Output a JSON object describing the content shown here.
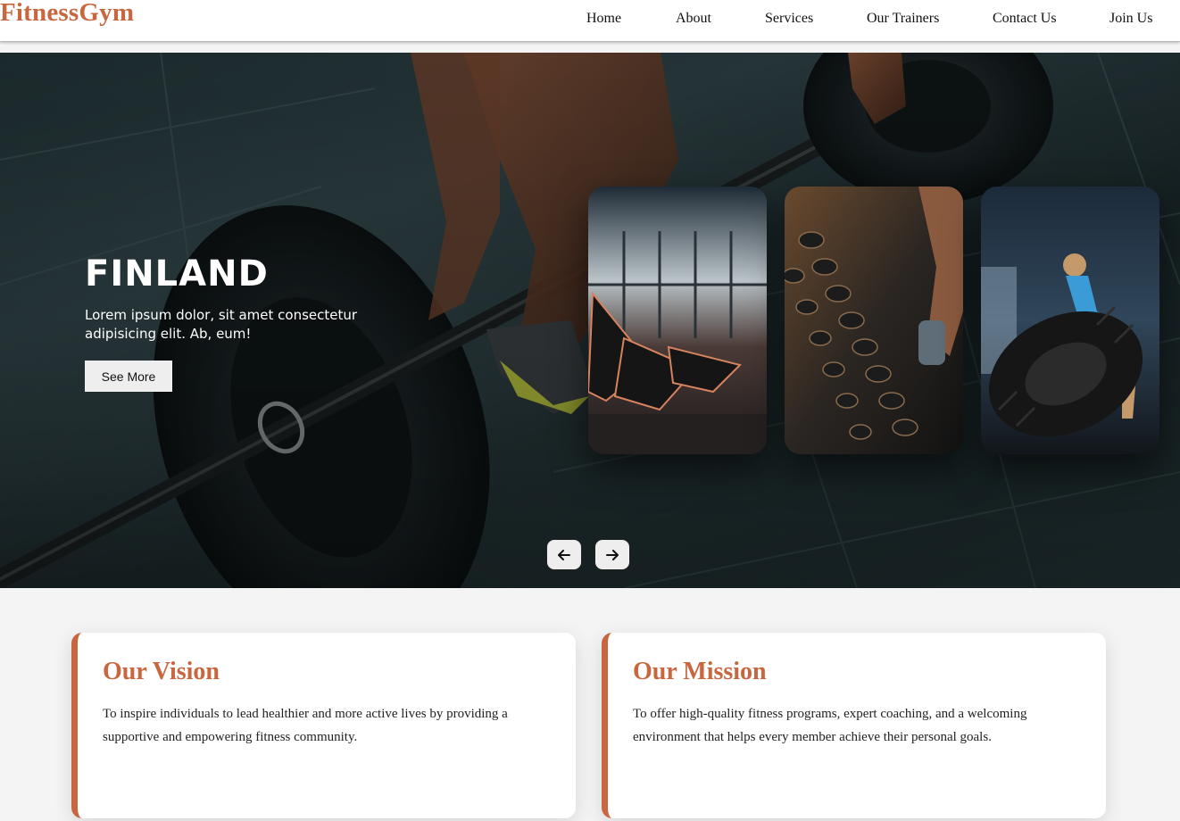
{
  "brand": {
    "logo": "FitnessGym",
    "accent_color": "#c8673f"
  },
  "nav": {
    "items": [
      {
        "label": "Home"
      },
      {
        "label": "About"
      },
      {
        "label": "Services"
      },
      {
        "label": "Our Trainers"
      },
      {
        "label": "Contact Us"
      },
      {
        "label": "Join Us"
      }
    ]
  },
  "hero": {
    "title": "FINLAND",
    "description": "Lorem ipsum dolor, sit amet consectetur adipisicing elit. Ab, eum!",
    "button_label": "See More",
    "prev_icon": "arrow-left-icon",
    "next_icon": "arrow-right-icon",
    "cards": [
      {
        "icon": "treadmill-photo"
      },
      {
        "icon": "dumbbell-rack-photo"
      },
      {
        "icon": "tire-flip-photo"
      }
    ]
  },
  "vision": {
    "title": "Our Vision",
    "text": "To inspire individuals to lead healthier and more active lives by providing a supportive and empowering fitness community."
  },
  "mission": {
    "title": "Our Mission",
    "text": "To offer high-quality fitness programs, expert coaching, and a welcoming environment that helps every member achieve their personal goals."
  }
}
